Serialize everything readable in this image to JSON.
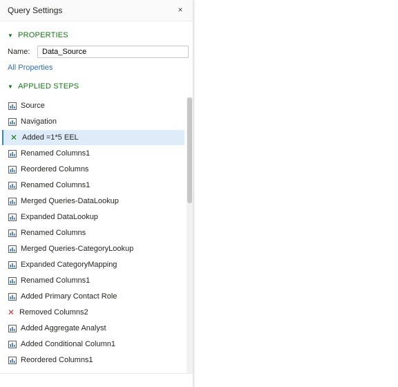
{
  "pane": {
    "title": "Query Settings",
    "close_label": "×"
  },
  "properties": {
    "header": "PROPERTIES",
    "name_label": "Name:",
    "name_value": "Data_Source",
    "all_properties_link": "All Properties"
  },
  "applied_steps": {
    "header": "APPLIED STEPS",
    "items": [
      {
        "label": "Source",
        "icon": "table-step-icon"
      },
      {
        "label": "Navigation",
        "icon": "table-step-icon"
      },
      {
        "label": "Added =1*5 EEL",
        "icon": "delete-step-icon",
        "selected": true
      },
      {
        "label": "Renamed Columns1",
        "icon": "table-step-icon"
      },
      {
        "label": "Reordered Columns",
        "icon": "table-step-icon"
      },
      {
        "label": "Renamed Columns1",
        "icon": "table-step-icon"
      },
      {
        "label": "Merged Queries-DataLookup",
        "icon": "table-step-icon"
      },
      {
        "label": "Expanded DataLookup",
        "icon": "table-step-icon"
      },
      {
        "label": "Renamed Columns",
        "icon": "table-step-icon"
      },
      {
        "label": "Merged Queries-CategoryLookup",
        "icon": "table-step-icon"
      },
      {
        "label": "Expanded CategoryMapping",
        "icon": "table-step-icon"
      },
      {
        "label": "Renamed Columns1",
        "icon": "table-step-icon"
      },
      {
        "label": "Added Primary Contact Role",
        "icon": "table-step-icon"
      },
      {
        "label": "Removed Columns2",
        "icon": "error-x-icon"
      },
      {
        "label": "Added Aggregate Analyst",
        "icon": "table-step-icon"
      },
      {
        "label": "Added Conditional Column1",
        "icon": "table-step-icon"
      },
      {
        "label": "Reordered Columns1",
        "icon": "table-step-icon"
      }
    ]
  },
  "colors": {
    "section_header": "#107c10",
    "link": "#2b6fc2",
    "selected_bg": "#deecf9",
    "selected_border": "#2b88d8",
    "delete_x": "#107c10",
    "error_x": "#d13438"
  }
}
